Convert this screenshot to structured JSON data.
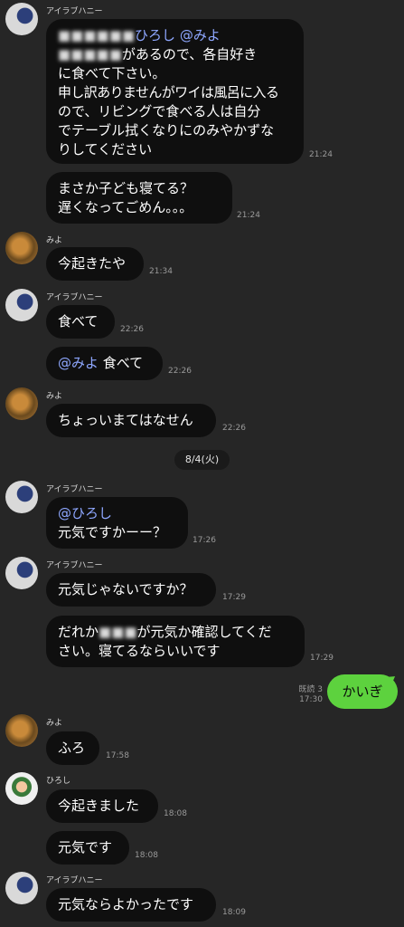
{
  "names": {
    "airabu": "アイラブハニー",
    "miyo": "みよ",
    "hiroshi": "ひろし"
  },
  "date_separator": "8/4(火)",
  "messages": {
    "m1": {
      "blur1": "■■■■■■",
      "mention1": "ひろし @みよ",
      "blur2": "■■■■■",
      "l2_rest": "があるので、各自好き",
      "l3": "に食べて下さい。",
      "l4": "申し訳ありませんがワイは風呂に入る",
      "l5": "ので、リビングで食べる人は自分",
      "l6": "でテーブル拭くなりにのみやかずな",
      "l7": "りしてください",
      "time": "21:24"
    },
    "m2": {
      "l1": "まさか子ども寝てる？",
      "l2": "遅くなってごめん。。。",
      "time": "21:24"
    },
    "m3": {
      "text": "今起きたや",
      "time": "21:34"
    },
    "m4": {
      "text": "食べて",
      "time": "22:26"
    },
    "m5": {
      "mention": "@みよ",
      "text": " 食べて",
      "time": "22:26"
    },
    "m6": {
      "text": "ちょっいまてはなせん",
      "time": "22:26"
    },
    "m7": {
      "mention": "@ひろし",
      "l2": "元気ですかーー？",
      "time": "17:26"
    },
    "m8": {
      "text": "元気じゃないですか？",
      "time": "17:29"
    },
    "m9": {
      "l1a": "だれか",
      "blur": "■■■",
      "l1b": "が元気か確認してくだ",
      "l2": "さい。寝てるならいいです",
      "time": "17:29"
    },
    "m10": {
      "text": "かいぎ",
      "read": "既読 3",
      "time": "17:30"
    },
    "m11": {
      "text": "ふろ",
      "time": "17:58"
    },
    "m12": {
      "text": "今起きました",
      "time": "18:08"
    },
    "m13": {
      "text": "元気です",
      "time": "18:08"
    },
    "m14": {
      "text": "元気ならよかったです",
      "time": "18:09"
    }
  },
  "colors": {
    "background": "#262626",
    "bubble_other": "#0f0f0f",
    "bubble_me": "#5dd23e",
    "mention": "#8ea7ff"
  }
}
